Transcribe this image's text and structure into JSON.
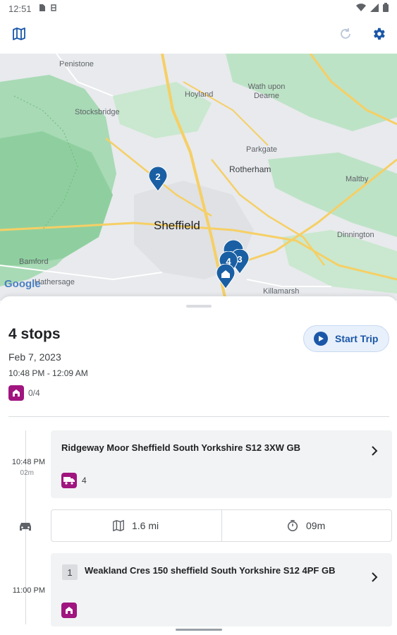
{
  "status_bar": {
    "time": "12:51"
  },
  "app_bar": {
    "map_icon": "map-icon",
    "refresh_icon": "refresh-icon",
    "settings_icon": "gear-icon"
  },
  "map": {
    "places": [
      "Penistone",
      "Stocksbridge",
      "Hoyland",
      "Wath upon Dearne",
      "Parkgate",
      "Rotherham",
      "Maltby",
      "Sheffield",
      "Dinnington",
      "Bamford",
      "Hathersage",
      "Killamarsh"
    ],
    "markers": [
      "2",
      "4",
      "3"
    ],
    "attribution": "Google"
  },
  "trip": {
    "title": "4 stops",
    "date": "Feb 7, 2023",
    "time_range": "10:48 PM - 12:09 AM",
    "progress": "0/4",
    "start_label": "Start Trip"
  },
  "stops": [
    {
      "time": "10:48 PM",
      "duration": "02m",
      "address": "Ridgeway Moor Sheffield South Yorkshire S12 3XW GB",
      "count": "4"
    },
    {
      "number": "1",
      "time": "11:00 PM",
      "address": "Weakland Cres 150 sheffield South Yorkshire S12 4PF GB"
    }
  ],
  "drive": {
    "distance": "1.6 mi",
    "duration": "09m"
  },
  "colors": {
    "accent": "#1a57a8",
    "badge": "#a0157f",
    "marker": "#1a5fa3",
    "map_green": "#a8dab5",
    "map_land": "#e8eaed",
    "road": "#f6cf65"
  }
}
